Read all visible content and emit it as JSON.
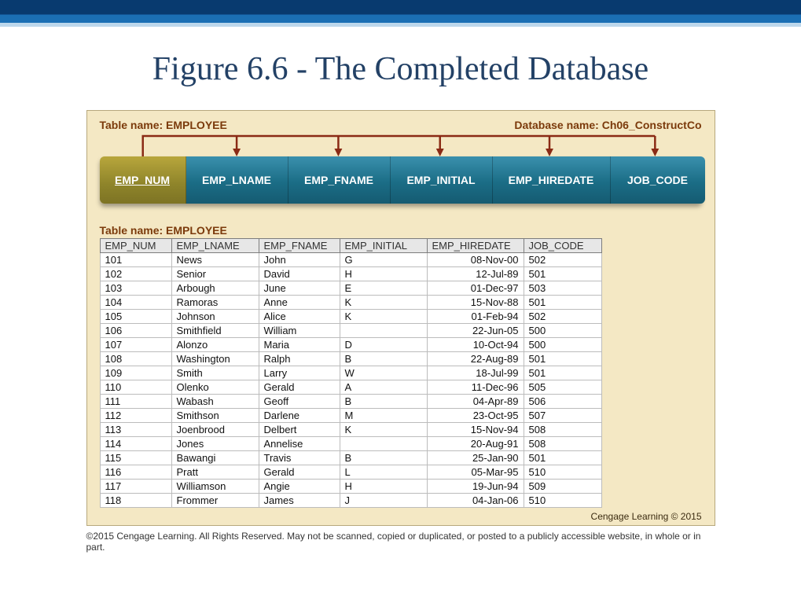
{
  "slide": {
    "title": "Figure 6.6 - The Completed Database"
  },
  "figure": {
    "table_name_label": "Table name: ",
    "table_name": "EMPLOYEE",
    "db_name_label": "Database name: ",
    "db_name": "Ch06_ConstructCo",
    "schema_columns": [
      "EMP_NUM",
      "EMP_LNAME",
      "EMP_FNAME",
      "EMP_INITIAL",
      "EMP_HIREDATE",
      "JOB_CODE"
    ],
    "data_table_label": "Table name: EMPLOYEE",
    "data_headers": [
      "EMP_NUM",
      "EMP_LNAME",
      "EMP_FNAME",
      "EMP_INITIAL",
      "EMP_HIREDATE",
      "JOB_CODE"
    ],
    "rows": [
      {
        "num": "101",
        "lname": "News",
        "fname": "John",
        "init": "G",
        "hire": "08-Nov-00",
        "job": "502"
      },
      {
        "num": "102",
        "lname": "Senior",
        "fname": "David",
        "init": "H",
        "hire": "12-Jul-89",
        "job": "501"
      },
      {
        "num": "103",
        "lname": "Arbough",
        "fname": "June",
        "init": "E",
        "hire": "01-Dec-97",
        "job": "503"
      },
      {
        "num": "104",
        "lname": "Ramoras",
        "fname": "Anne",
        "init": "K",
        "hire": "15-Nov-88",
        "job": "501"
      },
      {
        "num": "105",
        "lname": "Johnson",
        "fname": "Alice",
        "init": "K",
        "hire": "01-Feb-94",
        "job": "502"
      },
      {
        "num": "106",
        "lname": "Smithfield",
        "fname": "William",
        "init": "",
        "hire": "22-Jun-05",
        "job": "500"
      },
      {
        "num": "107",
        "lname": "Alonzo",
        "fname": "Maria",
        "init": "D",
        "hire": "10-Oct-94",
        "job": "500"
      },
      {
        "num": "108",
        "lname": "Washington",
        "fname": "Ralph",
        "init": "B",
        "hire": "22-Aug-89",
        "job": "501"
      },
      {
        "num": "109",
        "lname": "Smith",
        "fname": "Larry",
        "init": "W",
        "hire": "18-Jul-99",
        "job": "501"
      },
      {
        "num": "110",
        "lname": "Olenko",
        "fname": "Gerald",
        "init": "A",
        "hire": "11-Dec-96",
        "job": "505"
      },
      {
        "num": "111",
        "lname": "Wabash",
        "fname": "Geoff",
        "init": "B",
        "hire": "04-Apr-89",
        "job": "506"
      },
      {
        "num": "112",
        "lname": "Smithson",
        "fname": "Darlene",
        "init": "M",
        "hire": "23-Oct-95",
        "job": "507"
      },
      {
        "num": "113",
        "lname": "Joenbrood",
        "fname": "Delbert",
        "init": "K",
        "hire": "15-Nov-94",
        "job": "508"
      },
      {
        "num": "114",
        "lname": "Jones",
        "fname": "Annelise",
        "init": "",
        "hire": "20-Aug-91",
        "job": "508"
      },
      {
        "num": "115",
        "lname": "Bawangi",
        "fname": "Travis",
        "init": "B",
        "hire": "25-Jan-90",
        "job": "501"
      },
      {
        "num": "116",
        "lname": "Pratt",
        "fname": "Gerald",
        "init": "L",
        "hire": "05-Mar-95",
        "job": "510"
      },
      {
        "num": "117",
        "lname": "Williamson",
        "fname": "Angie",
        "init": "H",
        "hire": "19-Jun-94",
        "job": "509"
      },
      {
        "num": "118",
        "lname": "Frommer",
        "fname": "James",
        "init": "J",
        "hire": "04-Jan-06",
        "job": "510"
      }
    ],
    "credit": "Cengage Learning © 2015"
  },
  "footer": "©2015 Cengage Learning. All Rights Reserved. May not be scanned, copied or duplicated, or posted to a publicly accessible website, in whole or in part."
}
